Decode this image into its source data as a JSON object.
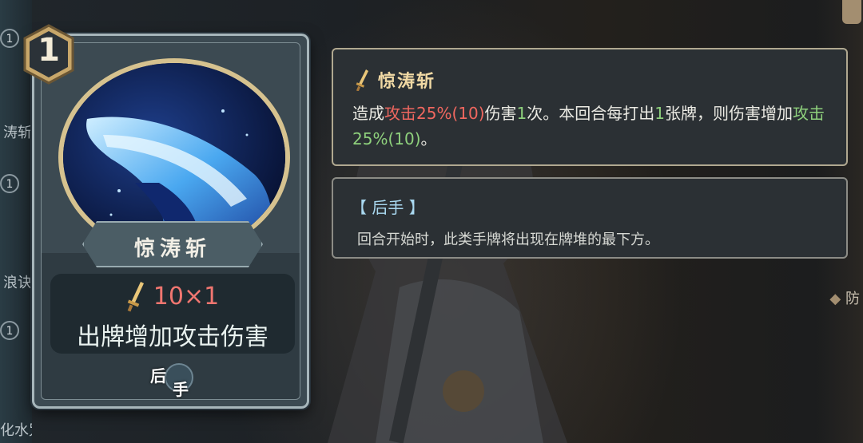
{
  "card": {
    "cost": "1",
    "name": "惊涛斩",
    "damage": "10×1",
    "effect": "出牌增加攻击伤害",
    "tag_char_1": "后",
    "tag_char_2": "手"
  },
  "tooltip_main": {
    "title": "惊涛斩",
    "desc_p1": "造成",
    "desc_attack_1": "攻击25%(10)",
    "desc_p2": "伤害",
    "desc_count": "1",
    "desc_p3": "次。本回合每打出",
    "desc_cards": "1",
    "desc_p4": "张牌，则伤害增加",
    "desc_attack_2": "攻击25%(10)",
    "desc_p5": "。"
  },
  "tooltip_keyword": {
    "title": "【 后手 】",
    "desc": "回合开始时，此类手牌将出现在牌堆的最下方。"
  },
  "side_list": {
    "item_1": "涛斩",
    "item_2": "浪诀",
    "item_3": "化水咒",
    "cost": "1"
  },
  "right_edge": {
    "item": "防"
  },
  "colors": {
    "accent_red": "#f0675f",
    "accent_green": "#8ed07c",
    "title_gold": "#f1d9a4",
    "keyword_blue": "#a9d8f0"
  },
  "icons": [
    "sword-icon",
    "ocean-wave-slash-art",
    "cost-badge-icon"
  ]
}
